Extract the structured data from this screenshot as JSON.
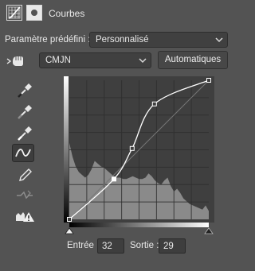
{
  "header": {
    "title": "Courbes",
    "icons": [
      "curves-adjustment-icon",
      "layer-mask-icon"
    ]
  },
  "preset": {
    "label": "Paramètre prédéfini :",
    "value": "Personnalisé"
  },
  "channel": {
    "value": "CMJN",
    "auto_label": "Automatiques"
  },
  "tools": [
    "eyedropper-black-icon",
    "eyedropper-gray-icon",
    "eyedropper-white-icon",
    "curve-points-icon",
    "pencil-icon",
    "smooth-curve-icon",
    "clipping-warning-icon"
  ],
  "curve": {
    "points": [
      [
        0,
        0
      ],
      [
        32,
        29
      ],
      [
        45,
        51
      ],
      [
        61,
        83
      ],
      [
        100,
        100
      ]
    ]
  },
  "io": {
    "input_label": "Entrée :",
    "input_value": "32",
    "output_label": "Sortie :",
    "output_value": "29"
  },
  "colors": {
    "panel_bg": "#535353",
    "grid_bg": "#3f3f3f",
    "histogram": "#8a8a8a",
    "curve": "#ffffff"
  }
}
